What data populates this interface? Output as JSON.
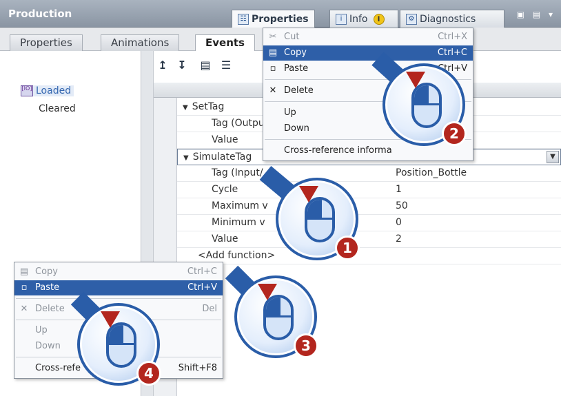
{
  "titlebar": {
    "title": "Production",
    "tabs": [
      {
        "label": "Properties",
        "icon": "properties-icon"
      },
      {
        "label": "Info",
        "icon": "info-icon"
      },
      {
        "label": "Diagnostics",
        "icon": "diagnostics-icon"
      }
    ],
    "info_badge": "i"
  },
  "subtabs": [
    "Properties",
    "Animations",
    "Events"
  ],
  "events": [
    {
      "label": "Loaded",
      "selected": true,
      "icon_text": "[IO]"
    },
    {
      "label": "Cleared",
      "selected": false
    }
  ],
  "grid": {
    "rows": [
      {
        "name": "SetTag",
        "value": "",
        "expanded": true
      },
      {
        "name": "Tag (Outpu",
        "value": ""
      },
      {
        "name": "Value",
        "value": ""
      },
      {
        "name": "SimulateTag",
        "value": "",
        "expanded": true
      },
      {
        "name": "Tag (Input/",
        "value": "Position_Bottle"
      },
      {
        "name": "Cycle",
        "value": "1"
      },
      {
        "name": "Maximum v",
        "value": "50"
      },
      {
        "name": "Minimum v",
        "value": "0"
      },
      {
        "name": "Value",
        "value": "2"
      },
      {
        "name": "<Add function>",
        "value": ""
      }
    ]
  },
  "menu_top": {
    "items": [
      {
        "label": "Cut",
        "shortcut": "Ctrl+X",
        "disabled": true
      },
      {
        "label": "Copy",
        "shortcut": "Ctrl+C",
        "highlighted": true
      },
      {
        "label": "Paste",
        "shortcut": "Ctrl+V"
      },
      {
        "label": "Delete",
        "shortcut": ""
      },
      {
        "label": "Up",
        "shortcut": ""
      },
      {
        "label": "Down",
        "shortcut": ""
      },
      {
        "label": "Cross-reference informa",
        "shortcut": ""
      }
    ]
  },
  "menu_bottom": {
    "items": [
      {
        "label": "Copy",
        "shortcut": "Ctrl+C",
        "disabled": true
      },
      {
        "label": "Paste",
        "shortcut": "Ctrl+V",
        "highlighted": true
      },
      {
        "label": "Delete",
        "shortcut": "Del",
        "disabled": true
      },
      {
        "label": "Up",
        "shortcut": "",
        "disabled": true
      },
      {
        "label": "Down",
        "shortcut": "",
        "disabled": true
      },
      {
        "label": "Cross-refe",
        "shortcut": "Shift+F8"
      }
    ]
  },
  "callouts": [
    "1",
    "2",
    "3",
    "4"
  ],
  "colors": {
    "accent": "#2a5da8",
    "highlight": "#2e5fa8",
    "badge": "#b3261e"
  }
}
